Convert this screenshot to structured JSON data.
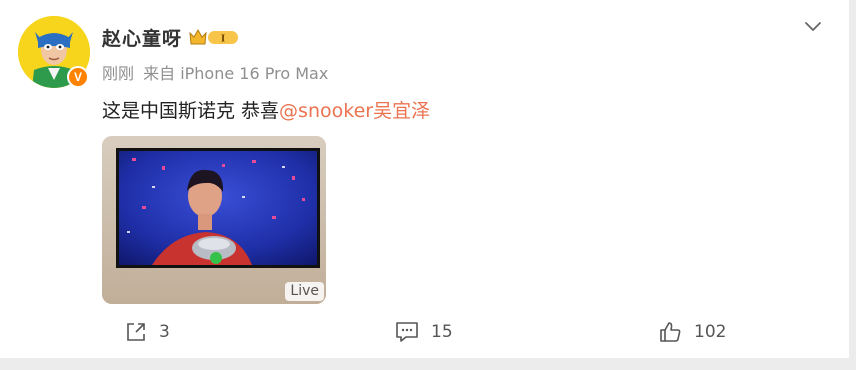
{
  "post": {
    "author": {
      "name": "赵心童呀",
      "level": "I",
      "verified_mark": "V"
    },
    "meta": {
      "time": "刚刚",
      "source": "来自 iPhone 16 Pro Max"
    },
    "text": {
      "body": "这是中国斯诺克 恭喜",
      "mention": "@snooker吴宜泽"
    },
    "media": {
      "badge": "Live"
    },
    "actions": {
      "share": {
        "count": "3",
        "icon": "share-icon"
      },
      "comment": {
        "count": "15",
        "icon": "comment-icon"
      },
      "like": {
        "count": "102",
        "icon": "thumbs-up-icon"
      }
    }
  },
  "colors": {
    "mention": "#eb7350",
    "accent_orange": "#ff8200",
    "muted_text": "#8f8f8f"
  }
}
